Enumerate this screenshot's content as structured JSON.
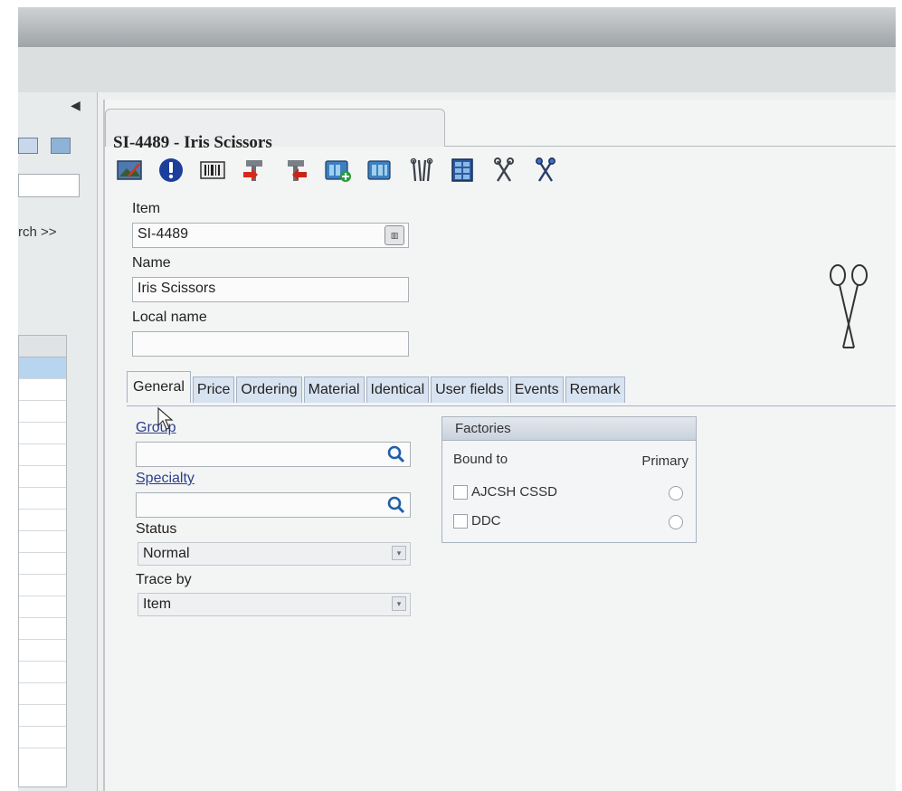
{
  "left_panel": {
    "search_link": "rch >>"
  },
  "window": {
    "title": "SI-4489 - Iris Scissors"
  },
  "toolbar": {
    "icons": [
      "image-icon",
      "info-icon",
      "barcode-icon",
      "tool-red-icon",
      "tool-green-icon",
      "grid-add-icon",
      "grid-icon",
      "instruments-icon",
      "container-icon",
      "scissors-icon",
      "scissors-blue-icon"
    ]
  },
  "form": {
    "item_label": "Item",
    "item_value": "SI-4489",
    "name_label": "Name",
    "name_value": "Iris Scissors",
    "local_name_label": "Local name",
    "local_name_value": ""
  },
  "tabs": [
    "General",
    "Price",
    "Ordering",
    "Material",
    "Identical",
    "User fields",
    "Events",
    "Remark"
  ],
  "general": {
    "group_label": "Group",
    "group_value": "",
    "specialty_label": "Specialty",
    "specialty_value": "",
    "status_label": "Status",
    "status_value": "Normal",
    "trace_label": "Trace by",
    "trace_value": "Item"
  },
  "factories": {
    "title": "Factories",
    "col_bound": "Bound to",
    "col_primary": "Primary",
    "rows": [
      {
        "name": "AJCSH CSSD"
      },
      {
        "name": "DDC"
      }
    ]
  },
  "colors": {
    "tab_bg": "#d8e3f1",
    "link": "#2b3f8e",
    "search_icon": "#1f5fa8"
  }
}
